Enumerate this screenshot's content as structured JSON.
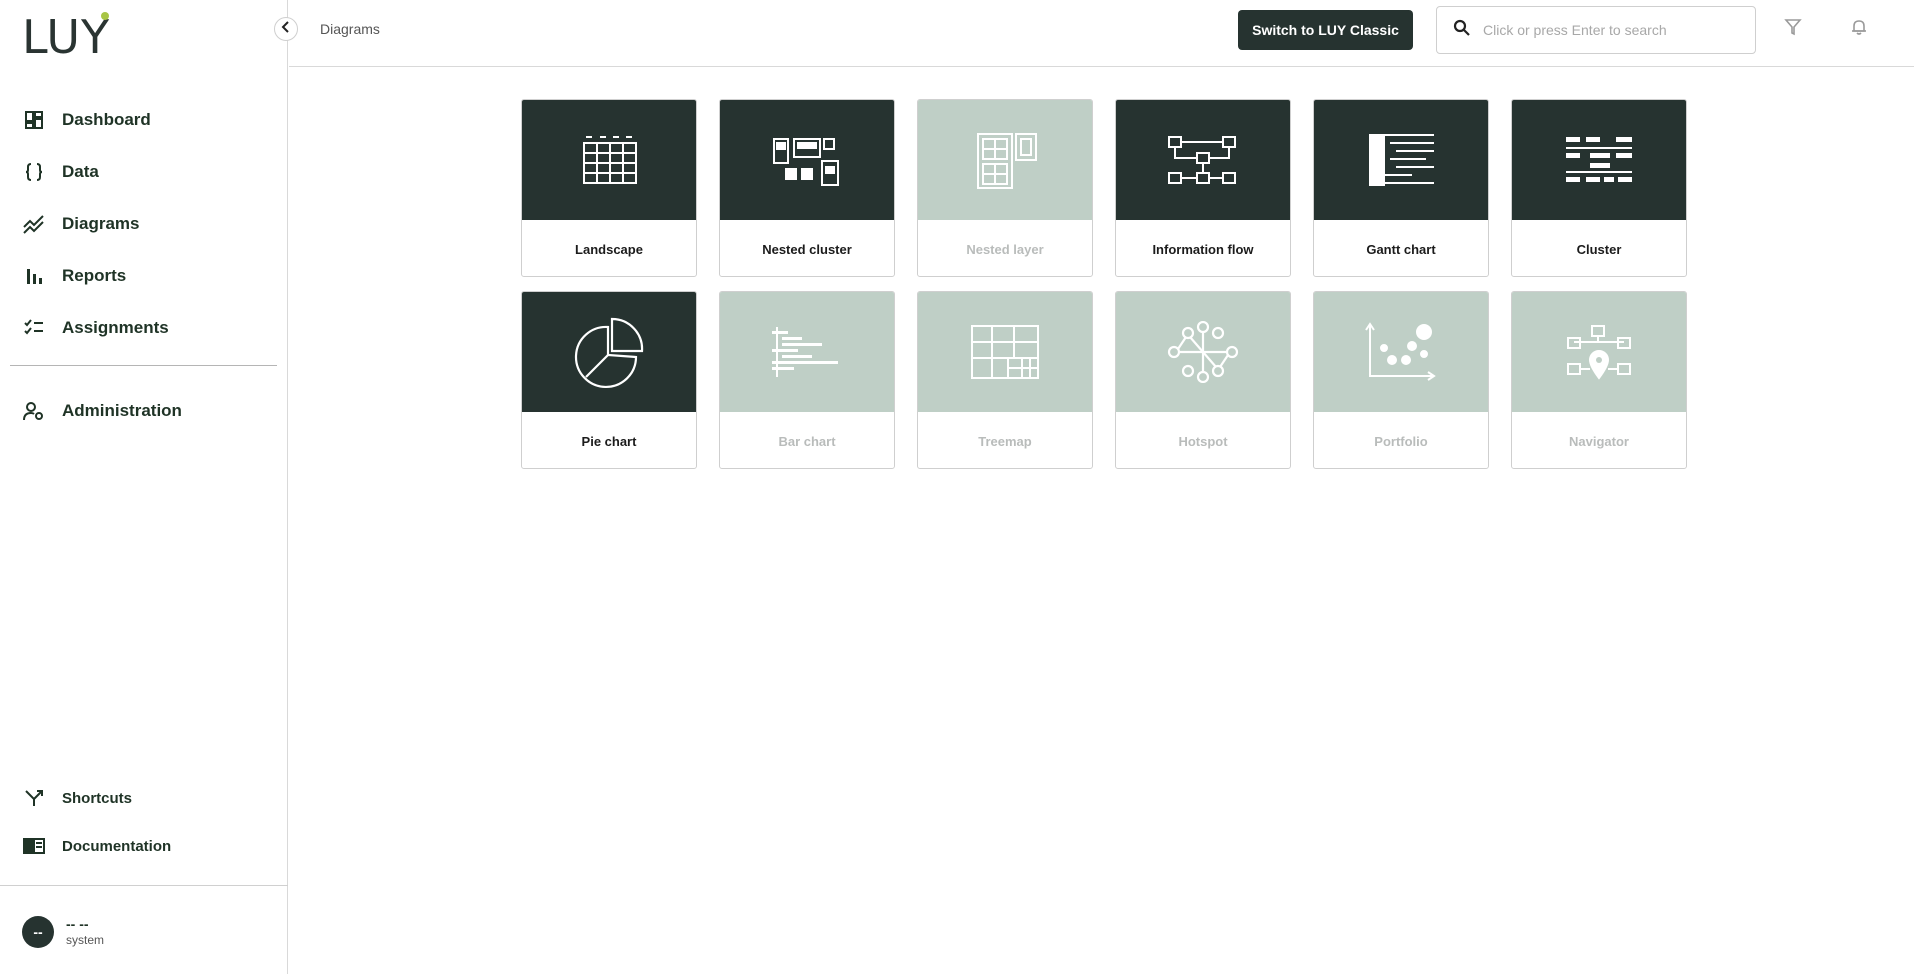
{
  "brand": {
    "logo_text": "LUY",
    "accent_color": "#a8c545",
    "dark_color": "#263330",
    "muted_color": "#bfcfc6"
  },
  "sidebar": {
    "items": [
      {
        "label": "Dashboard",
        "icon": "dashboard-icon"
      },
      {
        "label": "Data",
        "icon": "braces-icon"
      },
      {
        "label": "Diagrams",
        "icon": "trend-chart-icon"
      },
      {
        "label": "Reports",
        "icon": "bar-chart-icon"
      },
      {
        "label": "Assignments",
        "icon": "checklist-icon"
      }
    ],
    "admin": {
      "label": "Administration",
      "icon": "user-gear-icon"
    },
    "bottom": [
      {
        "label": "Shortcuts",
        "icon": "shortcut-arrows-icon"
      },
      {
        "label": "Documentation",
        "icon": "book-icon"
      }
    ],
    "user": {
      "initials": "--",
      "name": "-- --",
      "role": "system"
    }
  },
  "header": {
    "breadcrumb": "Diagrams",
    "switch_label": "Switch to LUY Classic",
    "search_placeholder": "Click or press Enter to search"
  },
  "cards": [
    {
      "label": "Landscape",
      "enabled": true,
      "icon": "landscape-icon"
    },
    {
      "label": "Nested cluster",
      "enabled": true,
      "icon": "nested-cluster-icon"
    },
    {
      "label": "Nested layer",
      "enabled": false,
      "icon": "nested-layer-icon"
    },
    {
      "label": "Information flow",
      "enabled": true,
      "icon": "information-flow-icon"
    },
    {
      "label": "Gantt chart",
      "enabled": true,
      "icon": "gantt-chart-icon"
    },
    {
      "label": "Cluster",
      "enabled": true,
      "icon": "cluster-icon"
    },
    {
      "label": "Pie chart",
      "enabled": true,
      "icon": "pie-chart-icon"
    },
    {
      "label": "Bar chart",
      "enabled": false,
      "icon": "bar-chart-icon"
    },
    {
      "label": "Treemap",
      "enabled": false,
      "icon": "treemap-icon"
    },
    {
      "label": "Hotspot",
      "enabled": false,
      "icon": "hotspot-icon"
    },
    {
      "label": "Portfolio",
      "enabled": false,
      "icon": "portfolio-icon"
    },
    {
      "label": "Navigator",
      "enabled": false,
      "icon": "navigator-icon"
    }
  ]
}
